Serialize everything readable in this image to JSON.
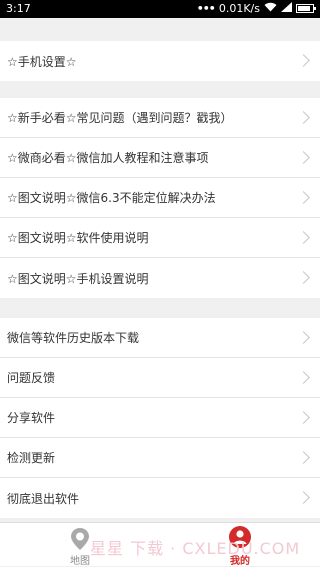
{
  "status_bar": {
    "time": "3:17",
    "network_speed": "0.01K/s"
  },
  "sections": [
    {
      "items": [
        "☆手机设置☆"
      ]
    },
    {
      "items": [
        "☆新手必看☆常见问题（遇到问题？戳我）",
        "☆微商必看☆微信加人教程和注意事项",
        "☆图文说明☆微信6.3不能定位解决办法",
        "☆图文说明☆软件使用说明",
        "☆图文说明☆手机设置说明"
      ]
    },
    {
      "items": [
        "微信等软件历史版本下载",
        "问题反馈",
        "分享软件",
        "检测更新",
        "彻底退出软件"
      ]
    }
  ],
  "tabbar": {
    "map_label": "地图",
    "mine_label": "我的",
    "active_color": "#d32a2a"
  },
  "watermark": "星星  下载 · CXLEDU.COM"
}
